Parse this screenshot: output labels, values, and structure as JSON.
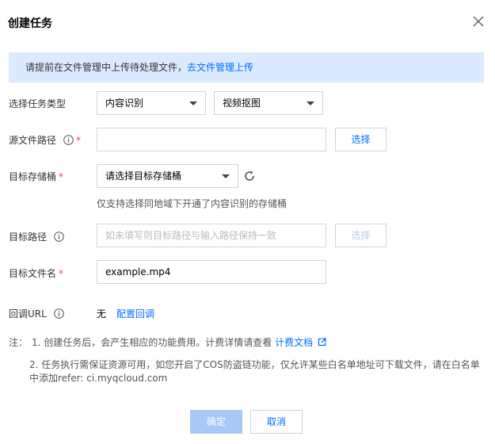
{
  "dialog": {
    "title": "创建任务"
  },
  "notice": {
    "text": "请提前在文件管理中上传待处理文件，",
    "link": "去文件管理上传"
  },
  "task_type": {
    "label": "选择任务类型",
    "primary_value": "内容识别",
    "secondary_value": "视频抠图"
  },
  "source_path": {
    "label": "源文件路径",
    "value": "",
    "select_button": "选择"
  },
  "target_bucket": {
    "label": "目标存储桶",
    "value": "请选择目标存储桶",
    "hint": "仅支持选择同地域下开通了内容识别的存储桶"
  },
  "target_path": {
    "label": "目标路径",
    "placeholder": "如未填写则目标路径与输入路径保持一致",
    "select_button": "选择"
  },
  "target_filename": {
    "label": "目标文件名",
    "value": "example.mp4"
  },
  "callback": {
    "label": "回调URL",
    "value": "无",
    "link": "配置回调"
  },
  "notes": {
    "prefix": "注：",
    "item1_text": "1. 创建任务后，会产生相应的功能费用。计费详情请查看",
    "item1_link": "计费文档",
    "item2_line1": "2. 任务执行需保证资源可用，如您开启了COS防盗链功能，仅允许某些白名单地址可下载文件，请在白名单",
    "item2_line2": "中添加refer: ci.myqcloud.com"
  },
  "footer": {
    "confirm": "确定",
    "cancel": "取消"
  },
  "colors": {
    "accent": "#006eff",
    "notice_bg": "#dceaff",
    "required": "#e54545",
    "disabled_primary": "#a8c9f5"
  },
  "icons": [
    "close-icon",
    "info-icon",
    "chevron-down-icon",
    "refresh-icon",
    "external-link-icon"
  ]
}
